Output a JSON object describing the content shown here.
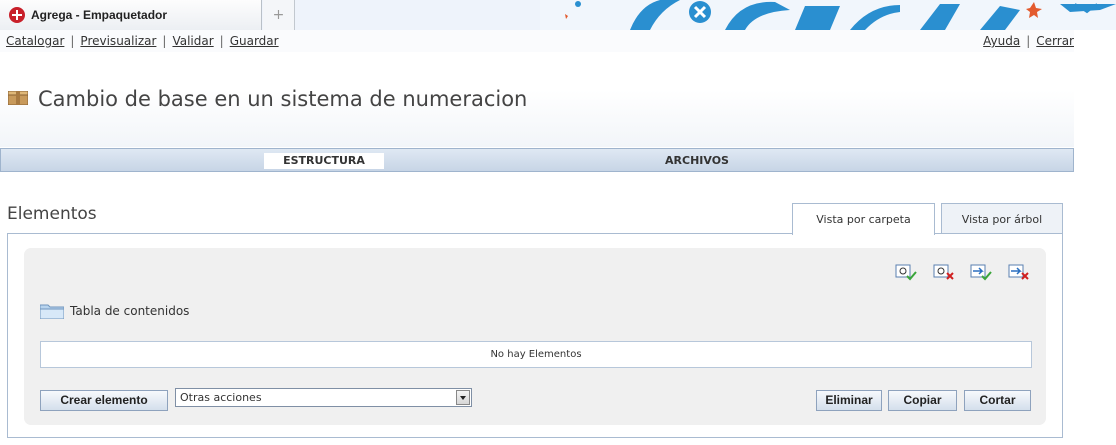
{
  "browser": {
    "tab_title": "Agrega - Empaquetador",
    "new_tab_symbol": "+"
  },
  "nav": {
    "left_links": [
      "Catalogar",
      "Previsualizar",
      "Validar",
      "Guardar"
    ],
    "right_links": [
      "Ayuda",
      "Cerrar"
    ],
    "separator": "|"
  },
  "header": {
    "title": "Cambio de base en un sistema de numeracion"
  },
  "main_tabs": [
    {
      "label": "ESTRUCTURA",
      "active": true
    },
    {
      "label": "ARCHIVOS",
      "active": false
    }
  ],
  "section": {
    "title": "Elementos",
    "view_tabs": [
      {
        "label": "Vista por carpeta",
        "active": true
      },
      {
        "label": "Vista por árbol",
        "active": false
      }
    ]
  },
  "panel": {
    "tree_item": "Tabla de contenidos",
    "empty_message": "No hay Elementos",
    "create_button": "Crear elemento",
    "other_actions": "Otras acciones",
    "delete_button": "Eliminar",
    "copy_button": "Copiar",
    "cut_button": "Cortar",
    "toolbar_icons": [
      "add-resource-icon",
      "remove-resource-icon",
      "add-link-icon",
      "remove-link-icon"
    ]
  },
  "colors": {
    "accent_border": "#a9bbd1",
    "tab_bar": "#c7d5e6",
    "brand_red": "#c8202a"
  }
}
